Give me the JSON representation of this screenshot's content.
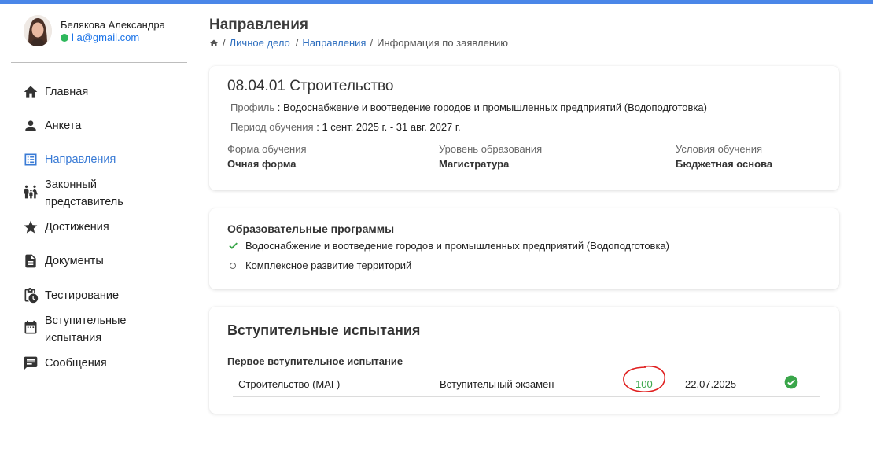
{
  "user": {
    "name": "Белякова Александра",
    "email": "l                     a@gmail.com"
  },
  "sidebar": {
    "items": [
      {
        "label": "Главная",
        "icon": "home-icon"
      },
      {
        "label": "Анкета",
        "icon": "person-icon"
      },
      {
        "label": "Направления",
        "icon": "list-icon",
        "active": true
      },
      {
        "label": "Законный представитель",
        "icon": "family-icon"
      },
      {
        "label": "Достижения",
        "icon": "star-icon"
      },
      {
        "label": "Документы",
        "icon": "document-icon"
      },
      {
        "label": "Тестирование",
        "icon": "clipboard-clock-icon"
      },
      {
        "label": "Вступительные испытания",
        "icon": "calendar-icon"
      },
      {
        "label": "Сообщения",
        "icon": "message-icon"
      }
    ]
  },
  "header": {
    "title": "Направления",
    "breadcrumb": {
      "home_icon": "home-icon",
      "items": [
        "Личное дело",
        "Направления"
      ],
      "current": "Информация по заявлению",
      "separator": "/"
    }
  },
  "specialty": {
    "title": "08.04.01 Строительство",
    "profile_label": "Профиль",
    "profile_value": ": Водоснабжение и воотведение городов и промышленных предприятий (Водоподготовка)",
    "period_label": "Период обучения",
    "period_value": ": 1 сент. 2025 г. - 31 авг. 2027 г.",
    "attributes": [
      {
        "label": "Форма обучения",
        "value": "Очная форма"
      },
      {
        "label": "Уровень образования",
        "value": "Магистратура"
      },
      {
        "label": "Условия обучения",
        "value": "Бюджетная основа"
      }
    ]
  },
  "programs": {
    "title": "Образовательные программы",
    "items": [
      {
        "label": "Водоснабжение и воотведение городов и промышленных предприятий (Водоподготовка)",
        "checked": true
      },
      {
        "label": "Комплексное развитие территорий",
        "checked": false
      }
    ]
  },
  "exams": {
    "title": "Вступительные испытания",
    "subtitle": "Первое вступительное испытание",
    "rows": [
      {
        "subject": "Строительство (МАГ)",
        "type": "Вступительный экзамен",
        "score": "100",
        "date": "22.07.2025",
        "status_icon": "check-circle-icon"
      }
    ]
  },
  "colors": {
    "accent": "#3a7bd5",
    "topbar": "#4a86e8",
    "success": "#3aa64a",
    "annotation": "#e02020"
  }
}
